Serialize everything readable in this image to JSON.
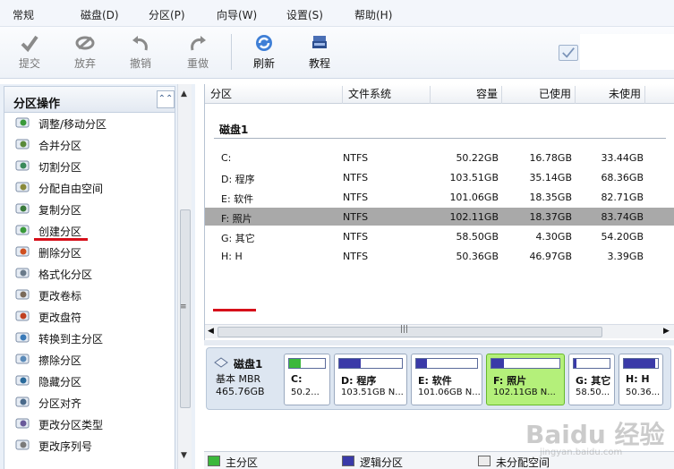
{
  "menu": [
    "常规",
    "磁盘(D)",
    "分区(P)",
    "向导(W)",
    "设置(S)",
    "帮助(H)"
  ],
  "toolbar": {
    "commit": "提交",
    "discard": "放弃",
    "undo": "撤销",
    "redo": "重做",
    "refresh": "刷新",
    "tutorial": "教程"
  },
  "left_panel": {
    "title": "分区操作",
    "items": [
      {
        "label": "调整/移动分区",
        "icon": "resize-icon"
      },
      {
        "label": "合并分区",
        "icon": "merge-icon"
      },
      {
        "label": "切割分区",
        "icon": "split-icon"
      },
      {
        "label": "分配自由空间",
        "icon": "allocate-icon"
      },
      {
        "label": "复制分区",
        "icon": "copy-icon"
      },
      {
        "label": "创建分区",
        "icon": "create-icon"
      },
      {
        "label": "删除分区",
        "icon": "delete-icon"
      },
      {
        "label": "格式化分区",
        "icon": "format-icon"
      },
      {
        "label": "更改卷标",
        "icon": "label-icon"
      },
      {
        "label": "更改盘符",
        "icon": "drive-letter-icon"
      },
      {
        "label": "转换到主分区",
        "icon": "convert-icon"
      },
      {
        "label": "擦除分区",
        "icon": "wipe-icon"
      },
      {
        "label": "隐藏分区",
        "icon": "hide-icon"
      },
      {
        "label": "分区对齐",
        "icon": "align-icon"
      },
      {
        "label": "更改分区类型",
        "icon": "type-icon"
      },
      {
        "label": "更改序列号",
        "icon": "serial-icon"
      }
    ]
  },
  "table": {
    "columns": [
      "分区",
      "文件系统",
      "容量",
      "已使用",
      "未使用"
    ],
    "disk_label": "磁盘1",
    "rows": [
      {
        "name": "C:",
        "fs": "NTFS",
        "capacity": "50.22GB",
        "used": "16.78GB",
        "free": "33.44GB"
      },
      {
        "name": "D: 程序",
        "fs": "NTFS",
        "capacity": "103.51GB",
        "used": "35.14GB",
        "free": "68.36GB"
      },
      {
        "name": "E: 软件",
        "fs": "NTFS",
        "capacity": "101.06GB",
        "used": "18.35GB",
        "free": "82.71GB"
      },
      {
        "name": "F: 照片",
        "fs": "NTFS",
        "capacity": "102.11GB",
        "used": "18.37GB",
        "free": "83.74GB"
      },
      {
        "name": "G: 其它",
        "fs": "NTFS",
        "capacity": "58.50GB",
        "used": "4.30GB",
        "free": "54.20GB"
      },
      {
        "name": "H: H",
        "fs": "NTFS",
        "capacity": "50.36GB",
        "used": "46.97GB",
        "free": "3.39GB"
      }
    ]
  },
  "disk_map": {
    "name": "磁盘1",
    "type": "基本 MBR",
    "size": "465.76GB",
    "partitions": [
      {
        "name": "C:",
        "size": "50.2...",
        "used_fraction": 0.33,
        "kind": "primary"
      },
      {
        "name": "D: 程序",
        "size": "103.51GB N...",
        "used_fraction": 0.34,
        "kind": "logical"
      },
      {
        "name": "E: 软件",
        "size": "101.06GB N...",
        "used_fraction": 0.18,
        "kind": "logical"
      },
      {
        "name": "F: 照片",
        "size": "102.11GB N...",
        "used_fraction": 0.18,
        "kind": "logical"
      },
      {
        "name": "G: 其它",
        "size": "58.50...",
        "used_fraction": 0.07,
        "kind": "logical"
      },
      {
        "name": "H: H",
        "size": "50.36...",
        "used_fraction": 0.93,
        "kind": "logical"
      }
    ]
  },
  "legend": {
    "primary": "主分区",
    "logical": "逻辑分区",
    "unallocated": "未分配空间"
  },
  "colors": {
    "primary": "#3cb83c",
    "logical": "#3a3aa8",
    "selected_row": "#a9a9a9",
    "selected_partition": "#b4f07a",
    "annotation_underline": "#d6101a"
  },
  "watermark": {
    "main": "Baidu 经验",
    "sub": "jingyan.baidu.com"
  }
}
